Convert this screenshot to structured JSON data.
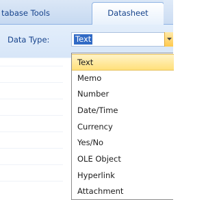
{
  "ribbon": {
    "tabs": [
      {
        "label": "tabase Tools"
      },
      {
        "label": "Datasheet"
      }
    ]
  },
  "data_type": {
    "label": "Data Type:",
    "value": "Text"
  },
  "dropdown": {
    "options": [
      "Text",
      "Memo",
      "Number",
      "Date/Time",
      "Currency",
      "Yes/No",
      "OLE Object",
      "Hyperlink",
      "Attachment"
    ],
    "selected": "Text"
  }
}
